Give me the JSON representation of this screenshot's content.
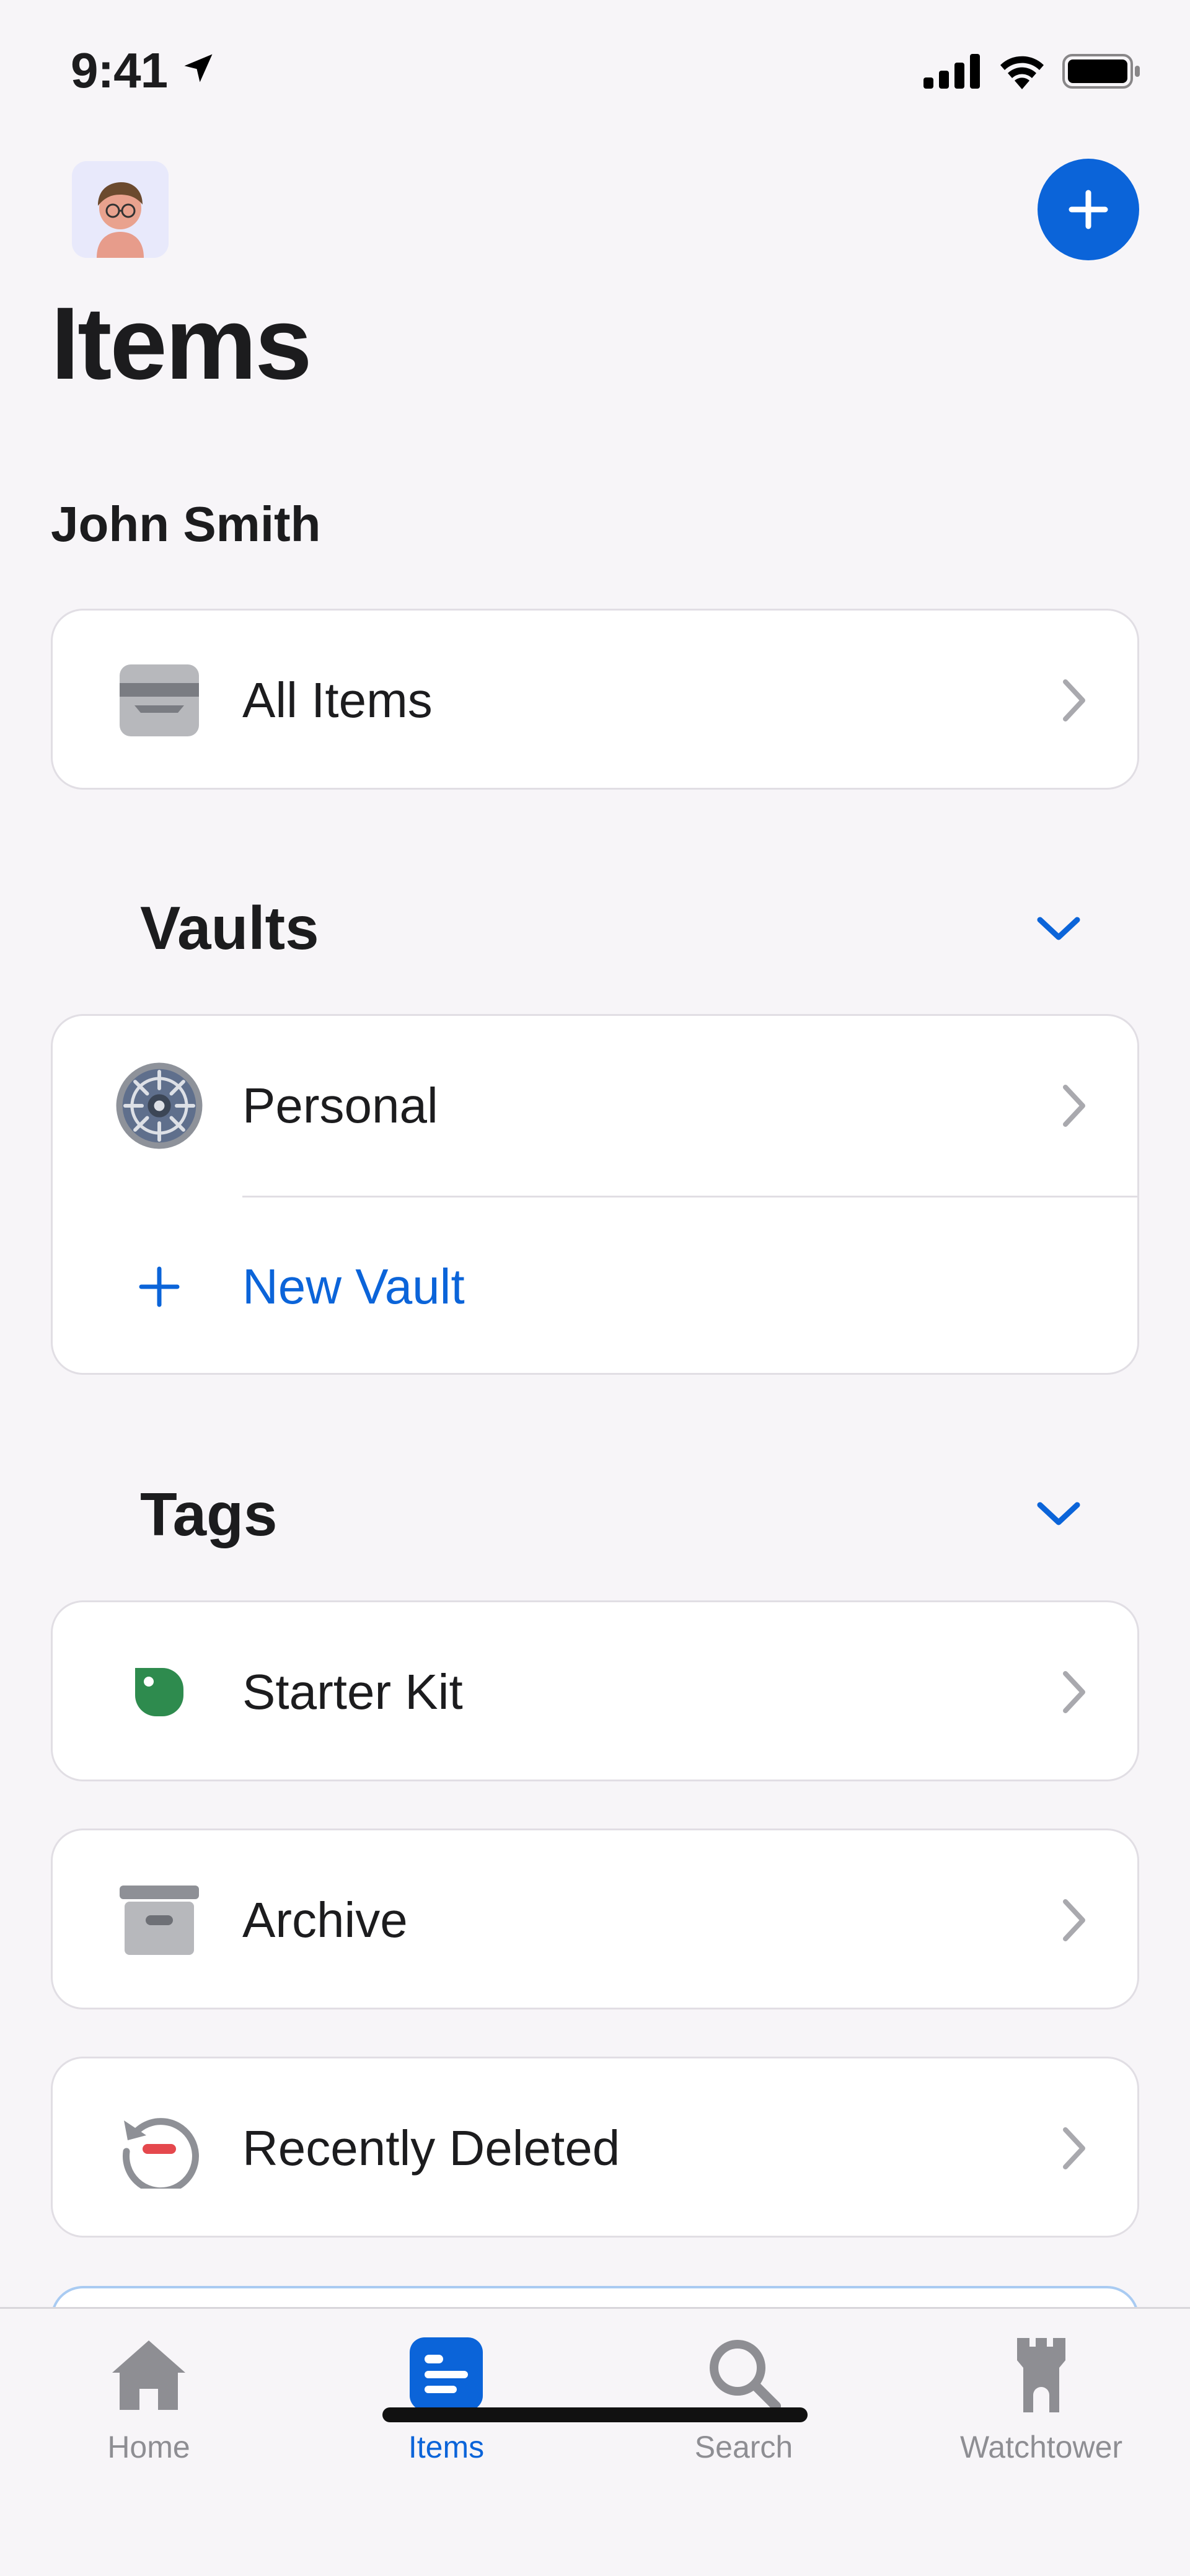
{
  "status_bar": {
    "time": "9:41"
  },
  "header": {
    "title": "Items",
    "account_name": "John Smith"
  },
  "all_items": {
    "label": "All Items"
  },
  "vaults": {
    "title": "Vaults",
    "items": [
      {
        "label": "Personal"
      }
    ],
    "new_vault_label": "New Vault"
  },
  "tags": {
    "title": "Tags",
    "items": [
      {
        "label": "Starter Kit"
      }
    ]
  },
  "archive": {
    "label": "Archive"
  },
  "recently_deleted": {
    "label": "Recently Deleted"
  },
  "tabbar": {
    "tabs": [
      {
        "label": "Home",
        "icon": "home-icon",
        "active": false
      },
      {
        "label": "Items",
        "icon": "items-icon",
        "active": true
      },
      {
        "label": "Search",
        "icon": "search-icon",
        "active": false
      },
      {
        "label": "Watchtower",
        "icon": "watchtower-icon",
        "active": false
      }
    ]
  },
  "colors": {
    "accent": "#0B64D9",
    "background": "#F7F5F8",
    "tag_green": "#2E8B4E",
    "deleted_red": "#E5484D",
    "icon_gray": "#8E8E93"
  }
}
